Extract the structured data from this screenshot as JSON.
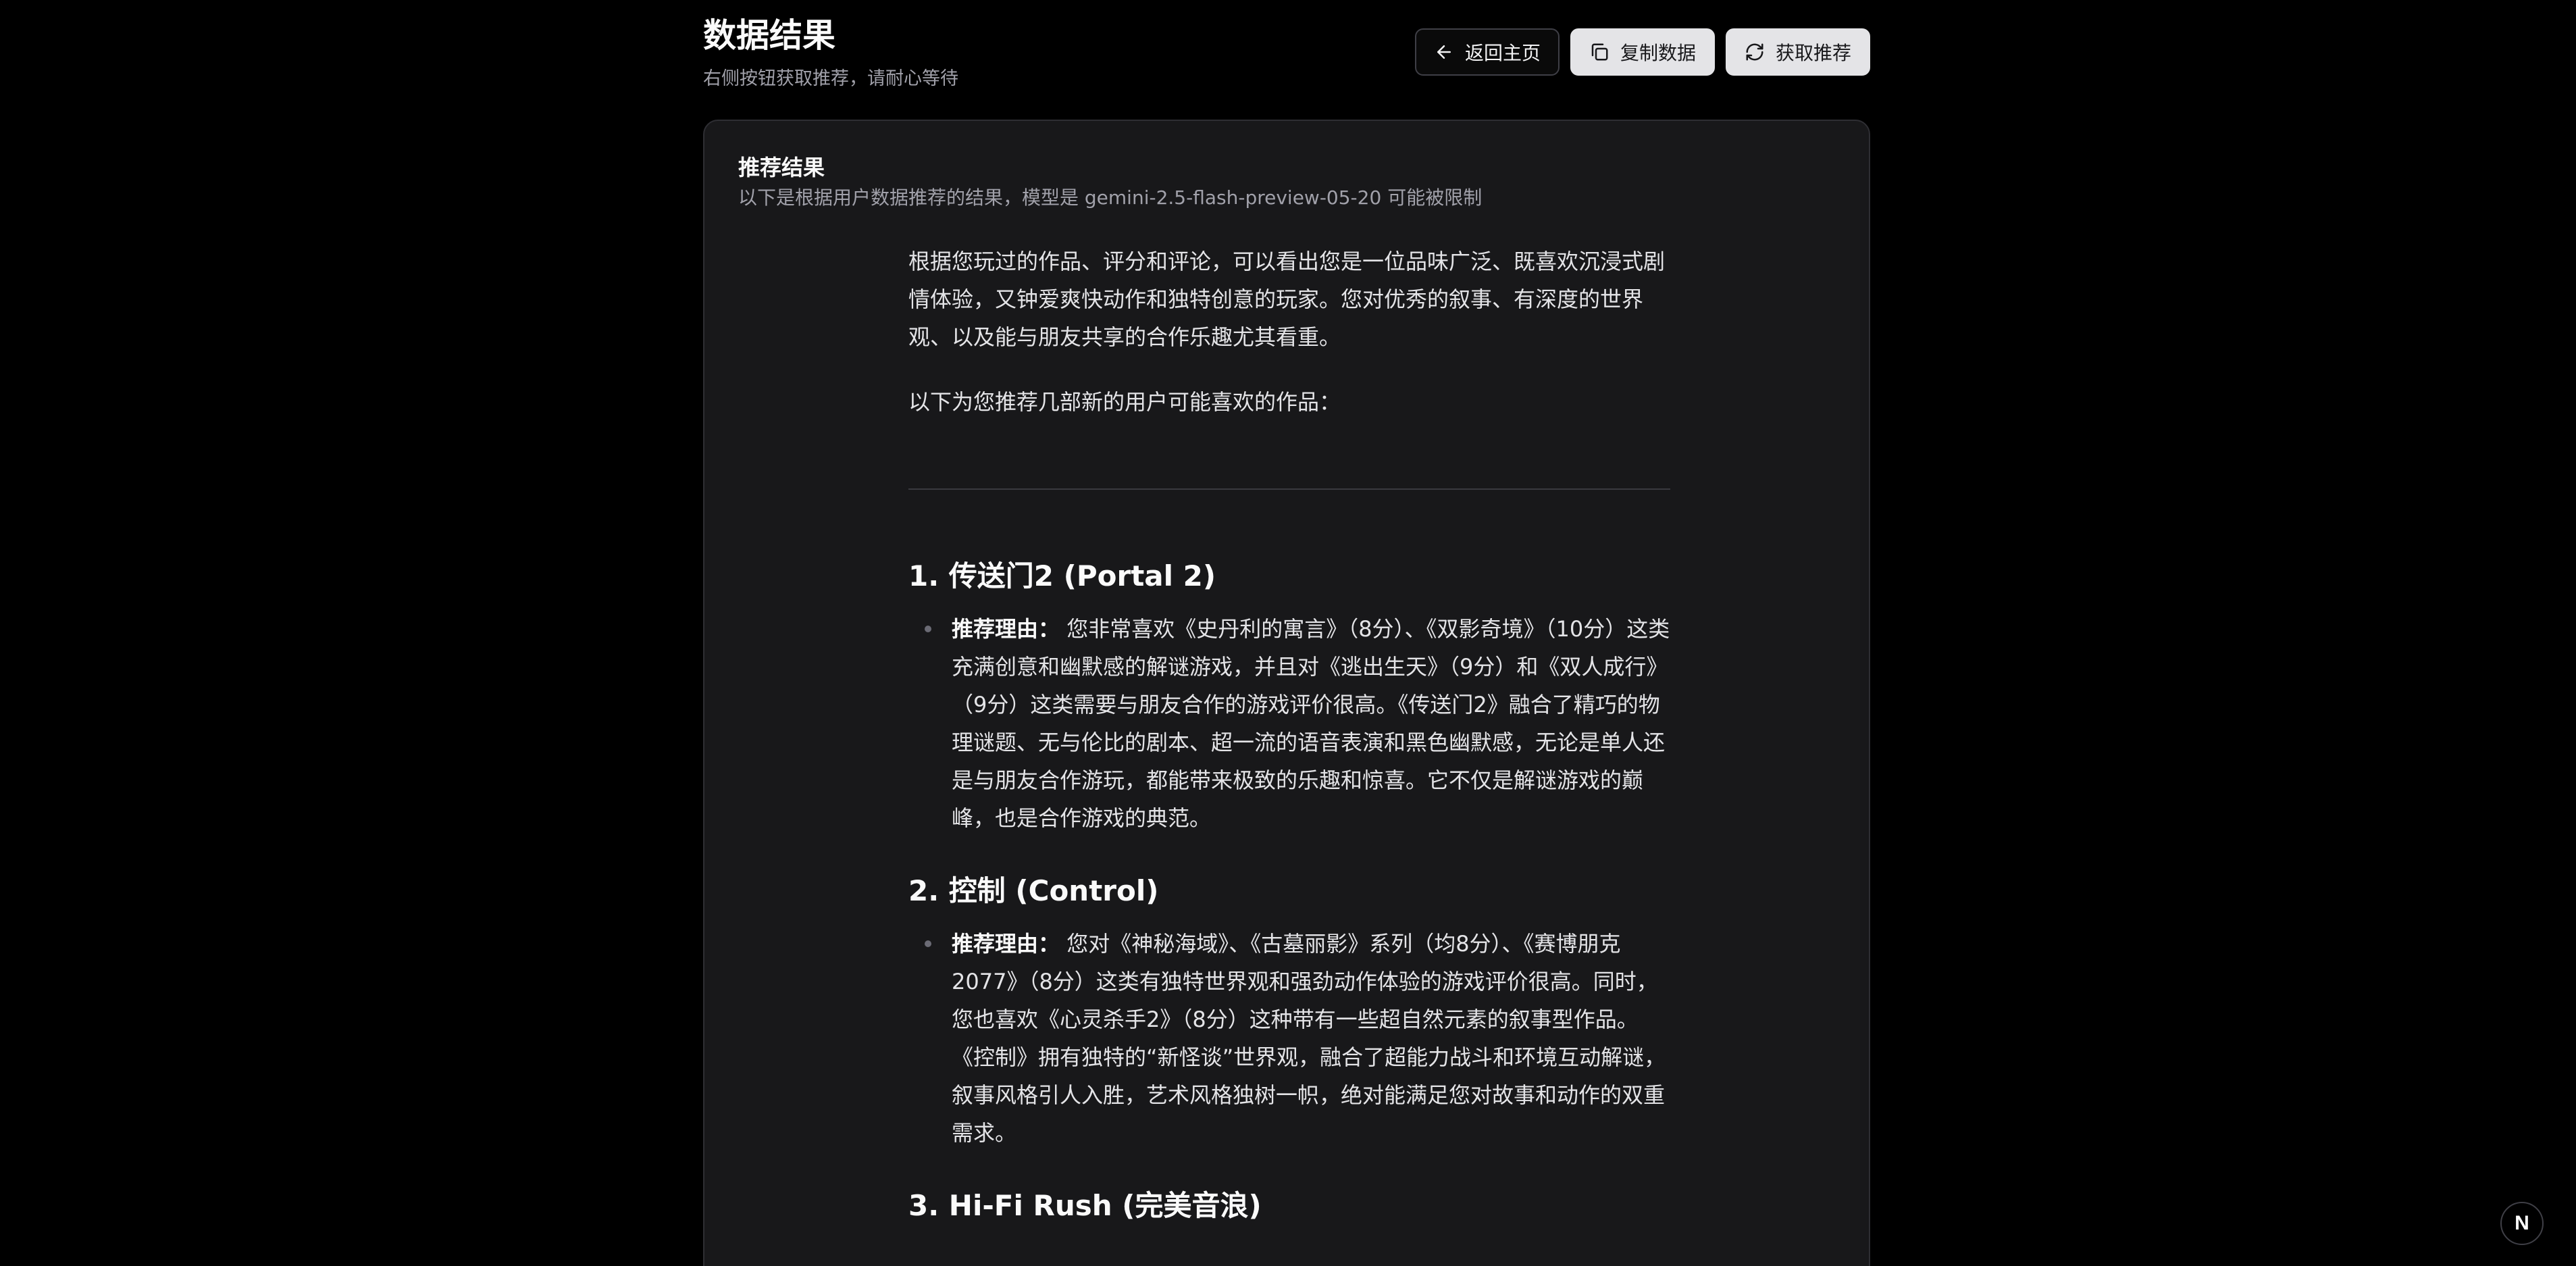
{
  "header": {
    "title": "数据结果",
    "subtitle": "右侧按钮获取推荐，请耐心等待",
    "buttons": {
      "back_label": "返回主页",
      "copy_label": "复制数据",
      "fetch_label": "获取推荐"
    }
  },
  "card": {
    "title": "推荐结果",
    "description": "以下是根据用户数据推荐的结果，模型是 gemini-2.5-flash-preview-05-20 可能被限制"
  },
  "content": {
    "intro": "根据您玩过的作品、评分和评论，可以看出您是一位品味广泛、既喜欢沉浸式剧情体验，又钟爱爽快动作和独特创意的玩家。您对优秀的叙事、有深度的世界观、以及能与朋友共享的合作乐趣尤其看重。",
    "lead": "以下为您推荐几部新的用户可能喜欢的作品：",
    "items": [
      {
        "title": "1. 传送门2 (Portal 2)",
        "label": "推荐理由：",
        "reason": "您非常喜欢《史丹利的寓言》（8分）、《双影奇境》（10分）这类充满创意和幽默感的解谜游戏，并且对《逃出生天》（9分）和《双人成行》（9分）这类需要与朋友合作的游戏评价很高。《传送门2》融合了精巧的物理谜题、无与伦比的剧本、超一流的语音表演和黑色幽默感，无论是单人还是与朋友合作游玩，都能带来极致的乐趣和惊喜。它不仅是解谜游戏的巅峰，也是合作游戏的典范。"
      },
      {
        "title": "2. 控制 (Control)",
        "label": "推荐理由：",
        "reason": "您对《神秘海域》、《古墓丽影》系列（均8分）、《赛博朋克2077》（8分）这类有独特世界观和强劲动作体验的游戏评价很高。同时，您也喜欢《心灵杀手2》（8分）这种带有一些超自然元素的叙事型作品。《控制》拥有独特的“新怪谈”世界观，融合了超能力战斗和环境互动解谜，叙事风格引人入胜，艺术风格独树一帜，绝对能满足您对故事和动作的双重需求。"
      },
      {
        "title": "3. Hi-Fi Rush (完美音浪)",
        "label": "",
        "reason": ""
      }
    ]
  },
  "badge": {
    "letter": "N"
  },
  "colors": {
    "background": "#000000",
    "card": "#18181a",
    "border": "#2e2e33",
    "muted_text": "#a1a1aa",
    "button_solid": "#e4e4e7"
  }
}
